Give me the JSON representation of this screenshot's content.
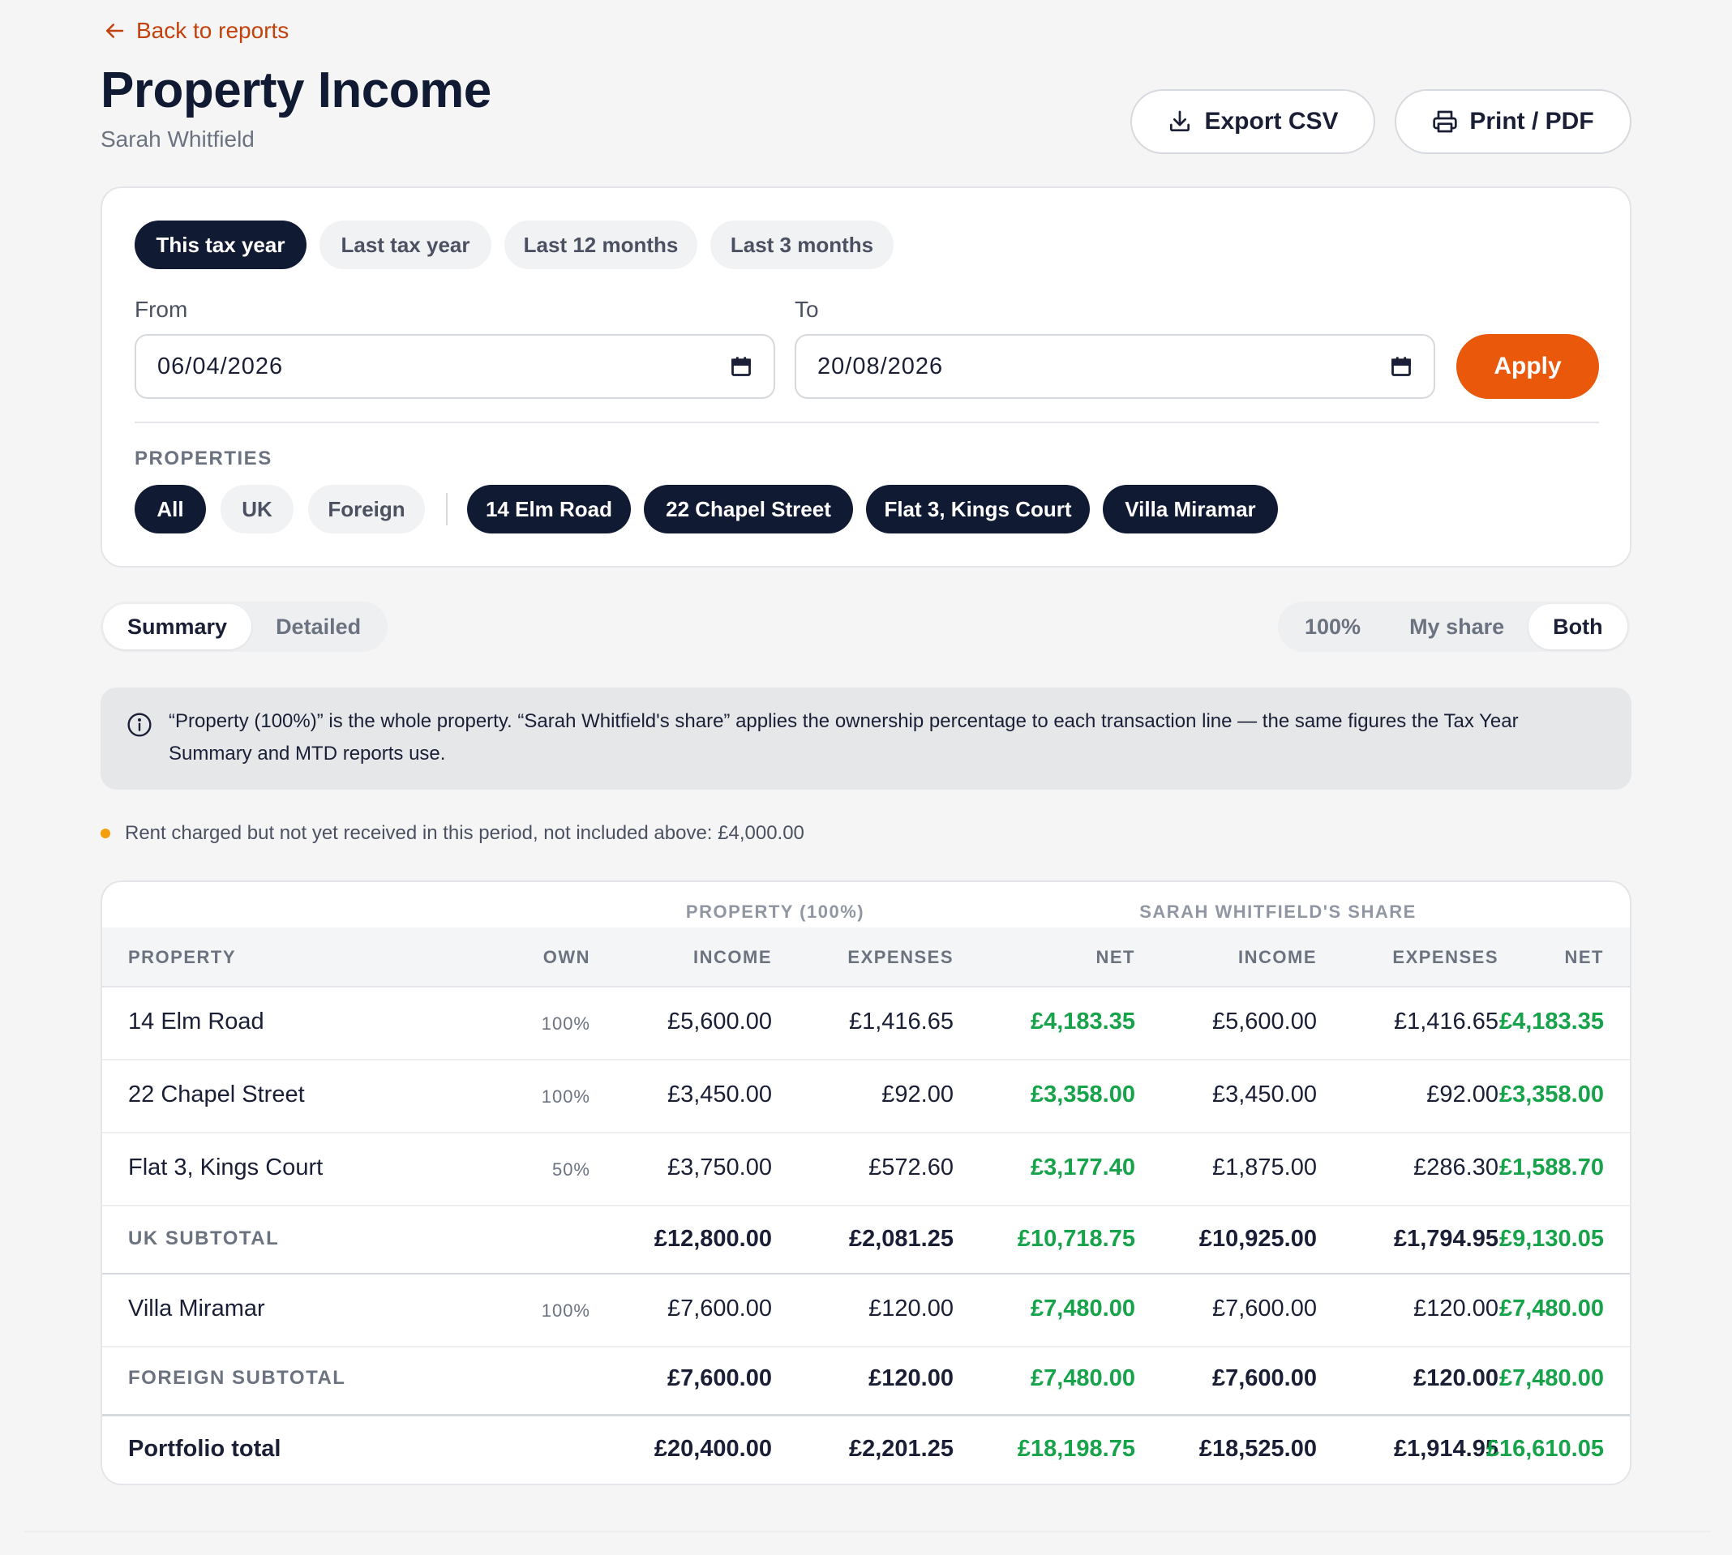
{
  "header": {
    "back_label": "Back to reports",
    "title": "Property Income",
    "owner": "Sarah Whitfield",
    "export_label": "Export CSV",
    "print_label": "Print / PDF"
  },
  "filters": {
    "periods": [
      "This tax year",
      "Last tax year",
      "Last 12 months",
      "Last 3 months"
    ],
    "active_period": "This tax year",
    "from_label": "From",
    "from_value": "06/04/2026",
    "to_label": "To",
    "to_value": "20/08/2026",
    "apply_label": "Apply",
    "properties_label": "PROPERTIES",
    "scope_pills": [
      "All",
      "UK",
      "Foreign"
    ],
    "property_pills": [
      "14 Elm Road",
      "22 Chapel Street",
      "Flat 3, Kings Court",
      "Villa Miramar"
    ]
  },
  "views": {
    "mode": [
      "Summary",
      "Detailed"
    ],
    "active_mode": "Summary",
    "share": [
      "100%",
      "My share",
      "Both"
    ],
    "active_share": "Both"
  },
  "info": {
    "text": "“Property (100%)” is the whole property. “Sarah Whitfield's share” applies the ownership percentage to each transaction line — the same figures the Tax Year Summary and MTD reports use."
  },
  "note": {
    "text": "Rent charged but not yet received in this period, not included above: £4,000.00"
  },
  "table": {
    "group_property": "PROPERTY (100%)",
    "group_share": "SARAH WHITFIELD'S SHARE",
    "columns": {
      "property": "PROPERTY",
      "own": "OWN",
      "income": "INCOME",
      "expenses": "EXPENSES",
      "net": "NET",
      "share_income": "INCOME",
      "share_expenses": "EXPENSES",
      "share_net": "NET"
    },
    "rows": [
      {
        "name": "14 Elm Road",
        "own": "100%",
        "income": "£5,600.00",
        "expenses": "£1,416.65",
        "net": "£4,183.35",
        "s_income": "£5,600.00",
        "s_expenses": "£1,416.65",
        "s_net": "£4,183.35"
      },
      {
        "name": "22 Chapel Street",
        "own": "100%",
        "income": "£3,450.00",
        "expenses": "£92.00",
        "net": "£3,358.00",
        "s_income": "£3,450.00",
        "s_expenses": "£92.00",
        "s_net": "£3,358.00"
      },
      {
        "name": "Flat 3, Kings Court",
        "own": "50%",
        "income": "£3,750.00",
        "expenses": "£572.60",
        "net": "£3,177.40",
        "s_income": "£1,875.00",
        "s_expenses": "£286.30",
        "s_net": "£1,588.70"
      },
      {
        "name": "UK SUBTOTAL",
        "own": "",
        "income": "£12,800.00",
        "expenses": "£2,081.25",
        "net": "£10,718.75",
        "s_income": "£10,925.00",
        "s_expenses": "£1,794.95",
        "s_net": "£9,130.05"
      },
      {
        "name": "Villa Miramar",
        "own": "100%",
        "income": "£7,600.00",
        "expenses": "£120.00",
        "net": "£7,480.00",
        "s_income": "£7,600.00",
        "s_expenses": "£120.00",
        "s_net": "£7,480.00"
      },
      {
        "name": "FOREIGN SUBTOTAL",
        "own": "",
        "income": "£7,600.00",
        "expenses": "£120.00",
        "net": "£7,480.00",
        "s_income": "£7,600.00",
        "s_expenses": "£120.00",
        "s_net": "£7,480.00"
      },
      {
        "name": "Portfolio total",
        "own": "",
        "income": "£20,400.00",
        "expenses": "£2,201.25",
        "net": "£18,198.75",
        "s_income": "£18,525.00",
        "s_expenses": "£1,914.95",
        "s_net": "£16,610.05"
      }
    ]
  },
  "colors": {
    "brand_accent": "#ea580c",
    "link": "#c2410c",
    "navy": "#111a33",
    "positive": "#16a34a",
    "warning_dot": "#f59e0b"
  }
}
